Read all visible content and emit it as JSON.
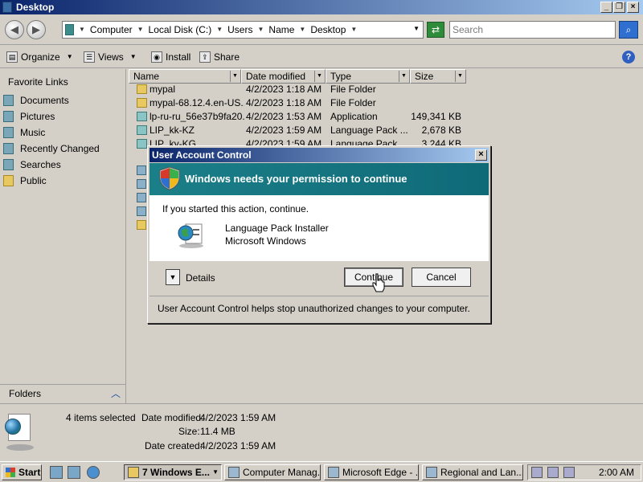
{
  "window": {
    "title": "Desktop"
  },
  "address": {
    "crumbs": [
      "Computer",
      "Local Disk (C:)",
      "Users",
      "Name",
      "Desktop"
    ],
    "search_placeholder": "Search"
  },
  "toolbar": {
    "organize": "Organize",
    "views": "Views",
    "install": "Install",
    "share": "Share"
  },
  "sidebar": {
    "heading": "Favorite Links",
    "items": [
      {
        "label": "Documents",
        "icon": "documents-icon"
      },
      {
        "label": "Pictures",
        "icon": "pictures-icon"
      },
      {
        "label": "Music",
        "icon": "music-icon"
      },
      {
        "label": "Recently Changed",
        "icon": "recently-changed-icon"
      },
      {
        "label": "Searches",
        "icon": "searches-icon"
      },
      {
        "label": "Public",
        "icon": "public-folder-icon"
      }
    ],
    "folders_label": "Folders"
  },
  "filelist": {
    "columns": [
      "Name",
      "Date modified",
      "Type",
      "Size"
    ],
    "rows": [
      {
        "name": "mypal",
        "date": "4/2/2023 1:18 AM",
        "type": "File Folder",
        "size": ""
      },
      {
        "name": "mypal-68.12.4.en-US....",
        "date": "4/2/2023 1:18 AM",
        "type": "File Folder",
        "size": ""
      },
      {
        "name": "lp-ru-ru_56e37b9fa20...",
        "date": "4/2/2023 1:53 AM",
        "type": "Application",
        "size": "149,341 KB"
      },
      {
        "name": "LIP_kk-KZ",
        "date": "4/2/2023 1:59 AM",
        "type": "Language Pack ...",
        "size": "2,678 KB"
      },
      {
        "name": "LIP_ky-KG",
        "date": "4/2/2023 1:59 AM",
        "type": "Language Pack ...",
        "size": "3,244 KB"
      }
    ]
  },
  "details": {
    "selected": "4 items selected",
    "date_modified_label": "Date modified:",
    "date_modified": "4/2/2023 1:59 AM",
    "size_label": "Size:",
    "size": "11.4 MB",
    "date_created_label": "Date created:",
    "date_created": "4/2/2023 1:59 AM"
  },
  "taskbar": {
    "start": "Start",
    "tasks": [
      "7 Windows E...",
      "Computer Manag...",
      "Microsoft Edge - ...",
      "Regional and Lan..."
    ],
    "clock": "2:00 AM"
  },
  "uac": {
    "title": "User Account Control",
    "banner": "Windows needs your permission to continue",
    "message": "If you started this action, continue.",
    "program_name": "Language Pack Installer",
    "publisher": "Microsoft Windows",
    "details_label": "Details",
    "continue_label": "Continue",
    "cancel_label": "Cancel",
    "footer": "User Account Control helps stop unauthorized changes to your computer."
  },
  "colors": {
    "title_start": "#0a246a",
    "title_end": "#a6caf0",
    "banner": "#1b7f88",
    "chrome": "#d4d0c8"
  }
}
